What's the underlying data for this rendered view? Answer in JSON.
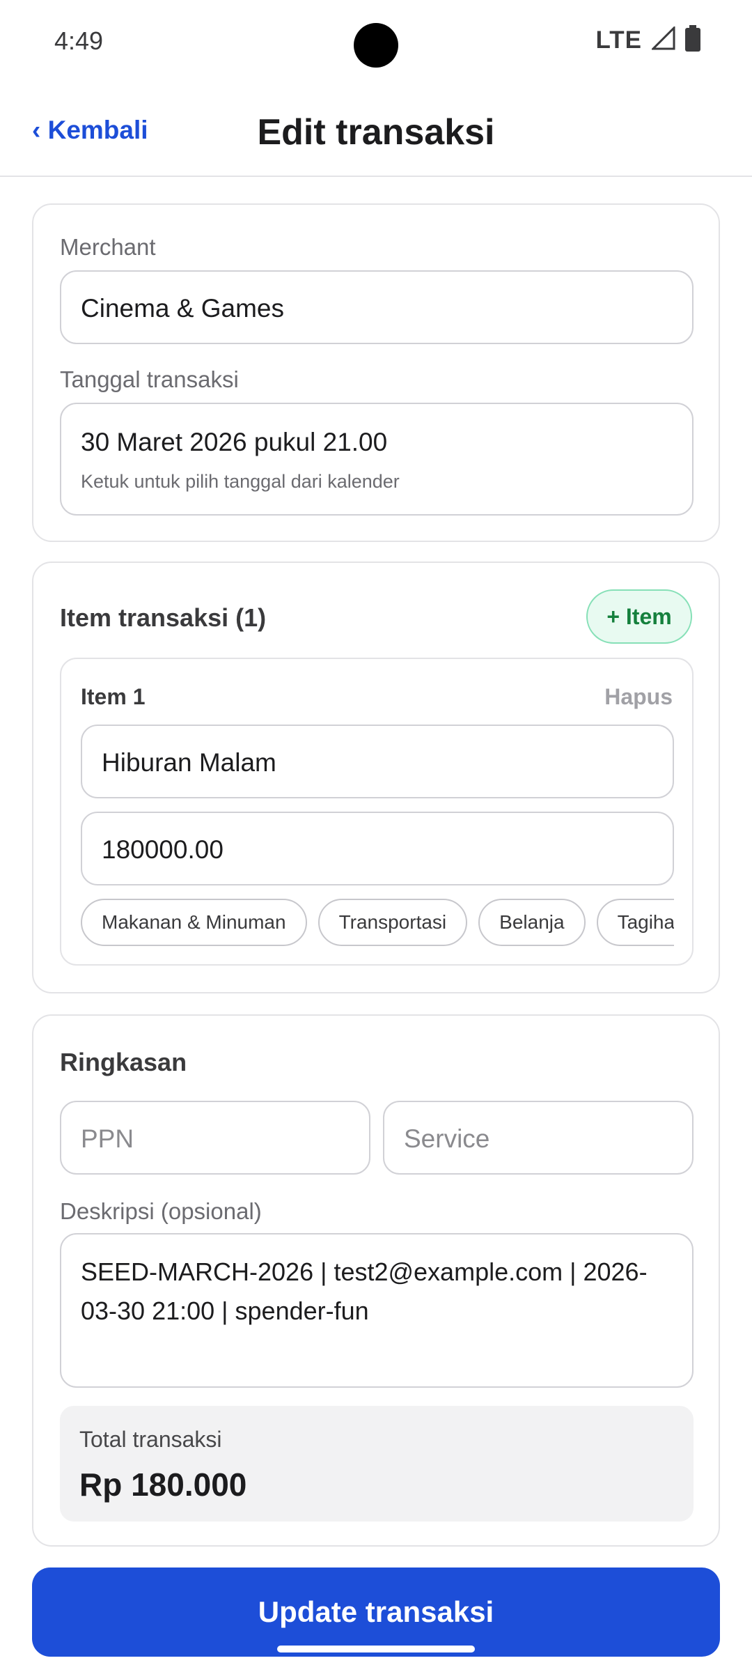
{
  "status_bar": {
    "time": "4:49",
    "network": "LTE",
    "icons": [
      "signal-icon",
      "battery-icon"
    ]
  },
  "header": {
    "back_label": "‹ Kembali",
    "title": "Edit transaksi"
  },
  "details": {
    "merchant_label": "Merchant",
    "merchant_value": "Cinema & Games",
    "date_label": "Tanggal transaksi",
    "date_value": "30 Maret 2026 pukul 21.00",
    "date_hint": "Ketuk untuk pilih tanggal dari kalender"
  },
  "items": {
    "title": "Item transaksi (1)",
    "add_label": "+ Item",
    "list": [
      {
        "title": "Item 1",
        "delete_label": "Hapus",
        "name": "Hiburan Malam",
        "amount": "180000.00",
        "categories": [
          "Makanan & Minuman",
          "Transportasi",
          "Belanja",
          "Tagihan"
        ]
      }
    ]
  },
  "summary": {
    "title": "Ringkasan",
    "ppn_placeholder": "PPN",
    "service_placeholder": "Service",
    "description_label": "Deskripsi (opsional)",
    "description_value": "SEED-MARCH-2026 | test2@example.com | 2026-03-30 21:00 | spender-fun",
    "total_label": "Total transaksi",
    "total_value": "Rp 180.000"
  },
  "actions": {
    "update_label": "Update transaksi"
  },
  "colors": {
    "primary": "#1d4ed8",
    "accent_green": "#15803d",
    "accent_green_bg": "#e8faf1"
  }
}
